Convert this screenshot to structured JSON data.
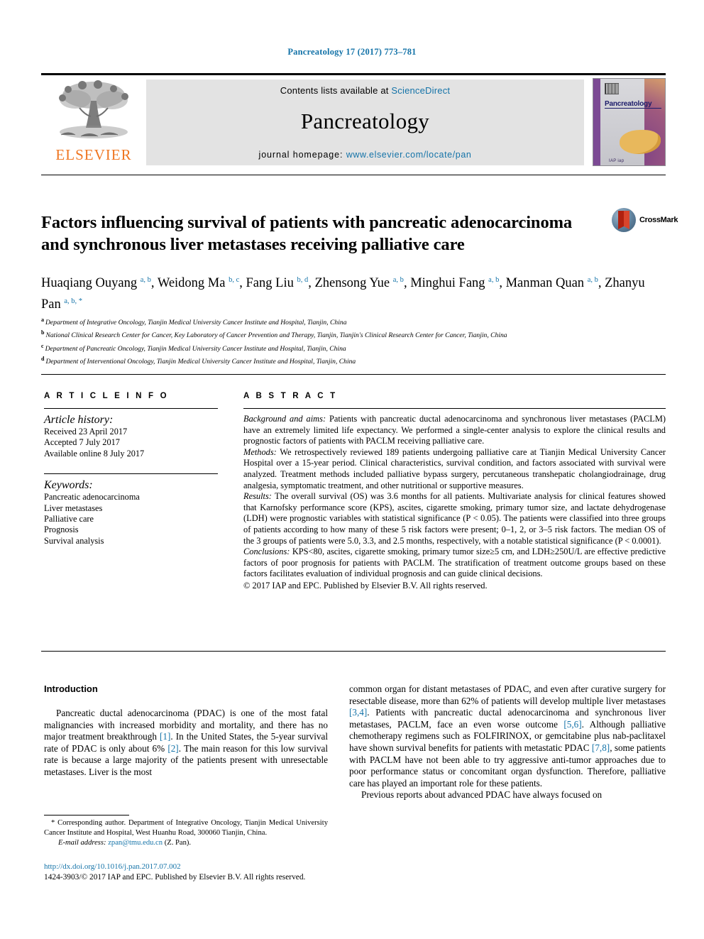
{
  "running_head": "Pancreatology 17 (2017) 773–781",
  "masthead": {
    "publisher_name": "ELSEVIER",
    "contents_prefix": "Contents lists available at ",
    "contents_link": "ScienceDirect",
    "journal_title": "Pancreatology",
    "homepage_label": "journal homepage: ",
    "homepage_url": "www.elsevier.com/locate/pan",
    "cover_title": "Pancreatology",
    "cover_footer": "IAP  iap"
  },
  "article": {
    "title": "Factors influencing survival of patients with pancreatic adenocarcinoma and synchronous liver metastases receiving palliative care",
    "crossmark_label": "CrossMark",
    "authors": [
      {
        "name": "Huaqiang Ouyang",
        "marks": "a, b",
        "sep": ", "
      },
      {
        "name": "Weidong Ma",
        "marks": "b, c",
        "sep": ", "
      },
      {
        "name": "Fang Liu",
        "marks": "b, d",
        "sep": ", "
      },
      {
        "name": "Zhensong Yue",
        "marks": "a, b",
        "sep": ", "
      },
      {
        "name": "Minghui Fang",
        "marks": "a, b",
        "sep": ", "
      },
      {
        "name": "Manman Quan",
        "marks": "a, b",
        "sep": ", "
      },
      {
        "name": "Zhanyu Pan",
        "marks": "a, b, *",
        "sep": ""
      }
    ],
    "affiliations": [
      {
        "mark": "a",
        "text": "Department of Integrative Oncology, Tianjin Medical University Cancer Institute and Hospital, Tianjin, China"
      },
      {
        "mark": "b",
        "text": "National Clinical Research Center for Cancer, Key Laboratory of Cancer Prevention and Therapy, Tianjin, Tianjin's Clinical Research Center for Cancer, Tianjin, China"
      },
      {
        "mark": "c",
        "text": "Department of Pancreatic Oncology, Tianjin Medical University Cancer Institute and Hospital, Tianjin, China"
      },
      {
        "mark": "d",
        "text": "Department of Interventional Oncology, Tianjin Medical University Cancer Institute and Hospital, Tianjin, China"
      }
    ]
  },
  "article_info": {
    "heading": "A R T I C L E   I N F O",
    "history_label": "Article history:",
    "history": [
      "Received 23 April 2017",
      "Accepted 7 July 2017",
      "Available online 8 July 2017"
    ],
    "keywords_label": "Keywords:",
    "keywords": [
      "Pancreatic adenocarcinoma",
      "Liver metastases",
      "Palliative care",
      "Prognosis",
      "Survival analysis"
    ]
  },
  "abstract": {
    "heading": "A B S T R A C T",
    "sections": [
      {
        "label": "Background and aims:",
        "text": " Patients with pancreatic ductal adenocarcinoma and synchronous liver metastases (PACLM) have an extremely limited life expectancy. We performed a single-center analysis to explore the clinical results and prognostic factors of patients with PACLM receiving palliative care."
      },
      {
        "label": "Methods:",
        "text": " We retrospectively reviewed 189 patients undergoing palliative care at Tianjin Medical University Cancer Hospital over a 15-year period. Clinical characteristics, survival condition, and factors associated with survival were analyzed. Treatment methods included palliative bypass surgery, percutaneous transhepatic cholangiodrainage, drug analgesia, symptomatic treatment, and other nutritional or supportive measures."
      },
      {
        "label": "Results:",
        "text": " The overall survival (OS) was 3.6 months for all patients. Multivariate analysis for clinical features showed that Karnofsky performance score (KPS), ascites, cigarette smoking, primary tumor size, and lactate dehydrogenase (LDH) were prognostic variables with statistical significance (P < 0.05). The patients were classified into three groups of patients according to how many of these 5 risk factors were present; 0–1, 2, or 3–5 risk factors. The median OS of the 3 groups of patients were 5.0, 3.3, and 2.5 months, respectively, with a notable statistical significance (P < 0.0001)."
      },
      {
        "label": "Conclusions:",
        "text": " KPS<80, ascites, cigarette smoking, primary tumor size≥5 cm, and LDH≥250U/L are effective predictive factors of poor prognosis for patients with PACLM. The stratification of treatment outcome groups based on these factors facilitates evaluation of individual prognosis and can guide clinical decisions."
      }
    ],
    "copyright": "© 2017 IAP and EPC. Published by Elsevier B.V. All rights reserved."
  },
  "introduction": {
    "heading": "Introduction",
    "left_para_1": "Pancreatic ductal adenocarcinoma (PDAC) is one of the most fatal malignancies with increased morbidity and mortality, and there has no major treatment breakthrough ",
    "left_ref_1": "[1]",
    "left_para_2": ". In the United States, the 5-year survival rate of PDAC is only about 6% ",
    "left_ref_2": "[2]",
    "left_para_3": ". The main reason for this low survival rate is because a large majority of the patients present with unresectable metastases. Liver is the most",
    "right_para_1": "common organ for distant metastases of PDAC, and even after curative surgery for resectable disease, more than 62% of patients will develop multiple liver metastases ",
    "right_ref_1": "[3,4]",
    "right_para_2": ". Patients with pancreatic ductal adenocarcinoma and synchronous liver metastases, PACLM, face an even worse outcome ",
    "right_ref_2": "[5,6]",
    "right_para_3": ". Although palliative chemotherapy regimens such as FOLFIRINOX, or gemcitabine plus nab-paclitaxel have shown survival benefits for patients with metastatic PDAC ",
    "right_ref_3": "[7,8]",
    "right_para_4": ", some patients with PACLM have not been able to try aggressive anti-tumor approaches due to poor performance status or concomitant organ dysfunction. Therefore, palliative care has played an important role for these patients.",
    "right_para_5": "Previous reports about advanced PDAC have always focused on"
  },
  "footnote": {
    "marker": "*",
    "text": " Corresponding author. Department of Integrative Oncology, Tianjin Medical University Cancer Institute and Hospital, West Huanhu Road, 300060 Tianjin, China.",
    "email_label": "E-mail address:",
    "email": "zpan@tmu.edu.cn",
    "email_suffix": " (Z. Pan)."
  },
  "doi_block": {
    "doi": "http://dx.doi.org/10.1016/j.pan.2017.07.002",
    "issn_line": "1424-3903/© 2017 IAP and EPC. Published by Elsevier B.V. All rights reserved."
  },
  "colors": {
    "link": "#1473a8",
    "elsevier_orange": "#ef7622",
    "banner_grey": "#e3e3e3"
  }
}
